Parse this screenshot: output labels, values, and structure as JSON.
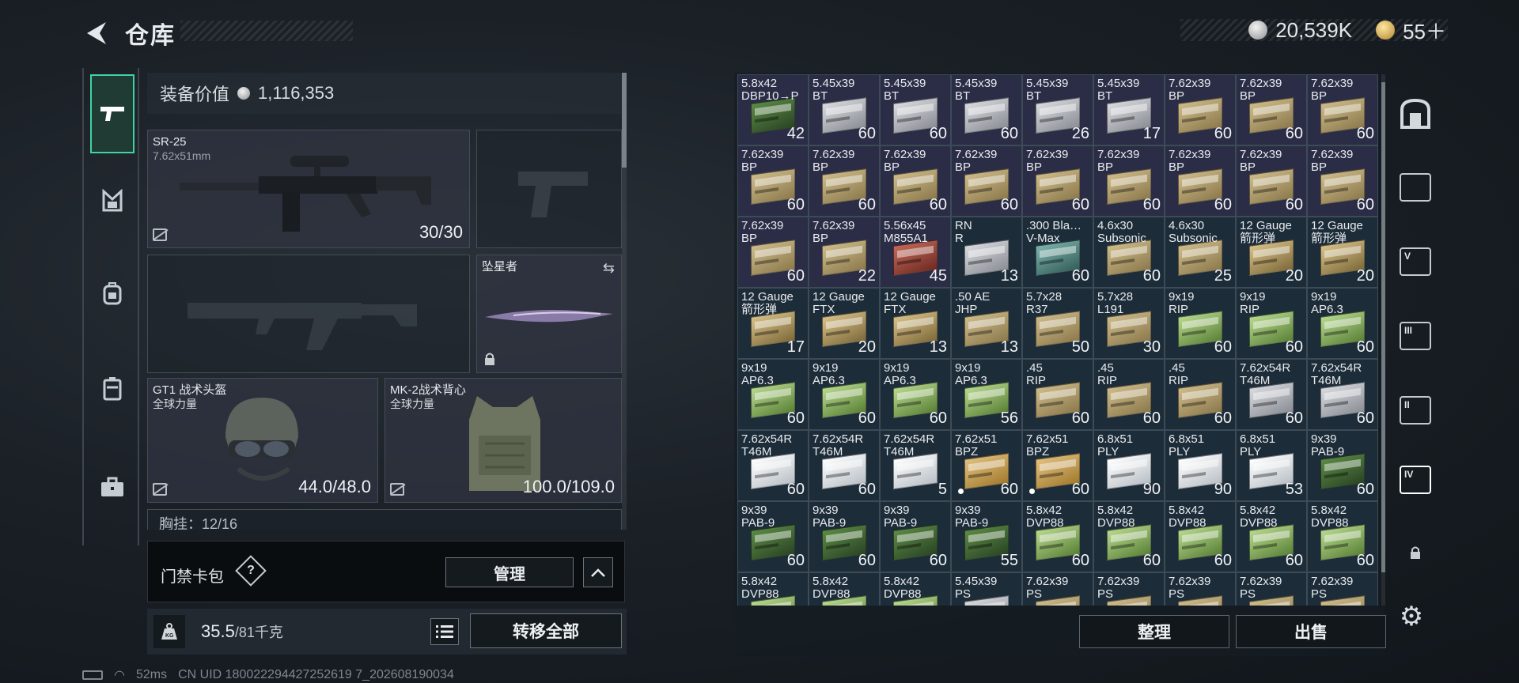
{
  "header": {
    "title": "仓库",
    "silver_amount": "20,539K",
    "gold_amount": "55＋"
  },
  "equipment": {
    "value_label": "装备价值",
    "value_amount": "1,116,353",
    "primary": {
      "name": "SR-25",
      "caliber": "7.62x51mm",
      "ammo": "30/30"
    },
    "melee": {
      "name": "坠星者"
    },
    "helmet": {
      "name": "GT1 战术头盔",
      "maker": "全球力量",
      "durability": "44.0/48.0"
    },
    "vest": {
      "name": "MK-2战术背心",
      "maker": "全球力量",
      "durability": "100.0/109.0"
    },
    "next_row_label": "胸挂：12/16"
  },
  "keycard": {
    "label": "门禁卡包",
    "help": "?",
    "manage": "管理"
  },
  "weight": {
    "current": "35.5",
    "max": "/81千克",
    "transfer_all": "转移全部"
  },
  "status": {
    "ping": "52ms",
    "uid": "CN UID 180022294427252619 7_202608190034"
  },
  "inventory_actions": {
    "sort": "整理",
    "sell": "出售"
  },
  "inventory_side_icons": [
    "bag-icon",
    "category-all-icon",
    "category-v-icon",
    "category-iii-icon",
    "category-ii-icon",
    "category-iv-icon",
    "lock-icon"
  ],
  "inventory": [
    {
      "cal": "5.8x42",
      "var": "DBP10→P",
      "qty": "42",
      "color": "darkgreen",
      "purple": true
    },
    {
      "cal": "5.45x39",
      "var": "BT",
      "qty": "60",
      "color": "silver",
      "purple": true
    },
    {
      "cal": "5.45x39",
      "var": "BT",
      "qty": "60",
      "color": "silver",
      "purple": true
    },
    {
      "cal": "5.45x39",
      "var": "BT",
      "qty": "60",
      "color": "silver",
      "purple": true
    },
    {
      "cal": "5.45x39",
      "var": "BT",
      "qty": "26",
      "color": "silver",
      "purple": true
    },
    {
      "cal": "5.45x39",
      "var": "BT",
      "qty": "17",
      "color": "silver",
      "purple": true
    },
    {
      "cal": "7.62x39",
      "var": "BP",
      "qty": "60",
      "color": "tan",
      "purple": true
    },
    {
      "cal": "7.62x39",
      "var": "BP",
      "qty": "60",
      "color": "tan",
      "purple": true
    },
    {
      "cal": "7.62x39",
      "var": "BP",
      "qty": "60",
      "color": "tan",
      "purple": true
    },
    {
      "cal": "7.62x39",
      "var": "BP",
      "qty": "60",
      "color": "tan",
      "purple": true
    },
    {
      "cal": "7.62x39",
      "var": "BP",
      "qty": "60",
      "color": "tan",
      "purple": true
    },
    {
      "cal": "7.62x39",
      "var": "BP",
      "qty": "60",
      "color": "tan",
      "purple": true
    },
    {
      "cal": "7.62x39",
      "var": "BP",
      "qty": "60",
      "color": "tan",
      "purple": true
    },
    {
      "cal": "7.62x39",
      "var": "BP",
      "qty": "60",
      "color": "tan",
      "purple": true
    },
    {
      "cal": "7.62x39",
      "var": "BP",
      "qty": "60",
      "color": "tan",
      "purple": true
    },
    {
      "cal": "7.62x39",
      "var": "BP",
      "qty": "60",
      "color": "tan",
      "purple": true
    },
    {
      "cal": "7.62x39",
      "var": "BP",
      "qty": "60",
      "color": "tan",
      "purple": true
    },
    {
      "cal": "7.62x39",
      "var": "BP",
      "qty": "60",
      "color": "tan",
      "purple": true
    },
    {
      "cal": "7.62x39",
      "var": "BP",
      "qty": "60",
      "color": "tan",
      "purple": true
    },
    {
      "cal": "7.62x39",
      "var": "BP",
      "qty": "22",
      "color": "tan",
      "purple": true
    },
    {
      "cal": "5.56x45",
      "var": "M855A1",
      "qty": "45",
      "color": "red",
      "purple": true
    },
    {
      "cal": "RN",
      "var": "R",
      "qty": "13",
      "color": "silver",
      "purple": false
    },
    {
      "cal": ".300 Bla…",
      "var": "V-Max",
      "qty": "60",
      "color": "teal",
      "purple": false
    },
    {
      "cal": "4.6x30",
      "var": "Subsonic",
      "qty": "60",
      "color": "tan",
      "purple": false
    },
    {
      "cal": "4.6x30",
      "var": "Subsonic",
      "qty": "25",
      "color": "tan",
      "purple": false
    },
    {
      "cal": "12 Gauge",
      "var": "箭形弹",
      "qty": "20",
      "color": "shells",
      "purple": false
    },
    {
      "cal": "12 Gauge",
      "var": "箭形弹",
      "qty": "20",
      "color": "shells",
      "purple": false
    },
    {
      "cal": "12 Gauge",
      "var": "箭形弹",
      "qty": "17",
      "color": "shells",
      "purple": false
    },
    {
      "cal": "12 Gauge",
      "var": "FTX",
      "qty": "20",
      "color": "shells",
      "purple": false
    },
    {
      "cal": "12 Gauge",
      "var": "FTX",
      "qty": "13",
      "color": "shells",
      "purple": false
    },
    {
      "cal": ".50 AE",
      "var": "JHP",
      "qty": "13",
      "color": "tan",
      "purple": false
    },
    {
      "cal": "5.7x28",
      "var": "R37",
      "qty": "50",
      "color": "tan",
      "purple": false
    },
    {
      "cal": "5.7x28",
      "var": "L191",
      "qty": "30",
      "color": "tan",
      "purple": false
    },
    {
      "cal": "9x19",
      "var": "RIP",
      "qty": "60",
      "color": "green",
      "purple": false
    },
    {
      "cal": "9x19",
      "var": "RIP",
      "qty": "60",
      "color": "green",
      "purple": false
    },
    {
      "cal": "9x19",
      "var": "AP6.3",
      "qty": "60",
      "color": "green",
      "purple": false
    },
    {
      "cal": "9x19",
      "var": "AP6.3",
      "qty": "60",
      "color": "green",
      "purple": false
    },
    {
      "cal": "9x19",
      "var": "AP6.3",
      "qty": "60",
      "color": "green",
      "purple": false
    },
    {
      "cal": "9x19",
      "var": "AP6.3",
      "qty": "60",
      "color": "green",
      "purple": false
    },
    {
      "cal": "9x19",
      "var": "AP6.3",
      "qty": "56",
      "color": "green",
      "purple": false
    },
    {
      "cal": ".45",
      "var": "RIP",
      "qty": "60",
      "color": "tan",
      "purple": false
    },
    {
      "cal": ".45",
      "var": "RIP",
      "qty": "60",
      "color": "tan",
      "purple": false
    },
    {
      "cal": ".45",
      "var": "RIP",
      "qty": "60",
      "color": "tan",
      "purple": false
    },
    {
      "cal": "7.62x54R",
      "var": "T46M",
      "qty": "60",
      "color": "silver",
      "purple": false
    },
    {
      "cal": "7.62x54R",
      "var": "T46M",
      "qty": "60",
      "color": "silver",
      "purple": false
    },
    {
      "cal": "7.62x54R",
      "var": "T46M",
      "qty": "60",
      "color": "white",
      "purple": false
    },
    {
      "cal": "7.62x54R",
      "var": "T46M",
      "qty": "60",
      "color": "white",
      "purple": false
    },
    {
      "cal": "7.62x54R",
      "var": "T46M",
      "qty": "5",
      "color": "white",
      "purple": false
    },
    {
      "cal": "7.62x51",
      "var": "BPZ",
      "qty": "60",
      "color": "gold",
      "purple": false,
      "dot": true
    },
    {
      "cal": "7.62x51",
      "var": "BPZ",
      "qty": "60",
      "color": "gold",
      "purple": false,
      "dot": true
    },
    {
      "cal": "6.8x51",
      "var": "PLY",
      "qty": "90",
      "color": "white",
      "purple": false
    },
    {
      "cal": "6.8x51",
      "var": "PLY",
      "qty": "90",
      "color": "white",
      "purple": false
    },
    {
      "cal": "6.8x51",
      "var": "PLY",
      "qty": "53",
      "color": "white",
      "purple": false
    },
    {
      "cal": "9x39",
      "var": "PAB-9",
      "qty": "60",
      "color": "darkgreen",
      "purple": false
    },
    {
      "cal": "9x39",
      "var": "PAB-9",
      "qty": "60",
      "color": "darkgreen",
      "purple": false
    },
    {
      "cal": "9x39",
      "var": "PAB-9",
      "qty": "60",
      "color": "darkgreen",
      "purple": false
    },
    {
      "cal": "9x39",
      "var": "PAB-9",
      "qty": "60",
      "color": "darkgreen",
      "purple": false
    },
    {
      "cal": "9x39",
      "var": "PAB-9",
      "qty": "55",
      "color": "darkgreen",
      "purple": false
    },
    {
      "cal": "5.8x42",
      "var": "DVP88",
      "qty": "60",
      "color": "green",
      "purple": false
    },
    {
      "cal": "5.8x42",
      "var": "DVP88",
      "qty": "60",
      "color": "green",
      "purple": false
    },
    {
      "cal": "5.8x42",
      "var": "DVP88",
      "qty": "60",
      "color": "green",
      "purple": false
    },
    {
      "cal": "5.8x42",
      "var": "DVP88",
      "qty": "60",
      "color": "green",
      "purple": false
    },
    {
      "cal": "5.8x42",
      "var": "DVP88",
      "qty": "60",
      "color": "green",
      "purple": false
    },
    {
      "cal": "5.8x42",
      "var": "DVP88",
      "qty": "",
      "color": "green",
      "purple": false
    },
    {
      "cal": "5.8x42",
      "var": "DVP88",
      "qty": "",
      "color": "green",
      "purple": false
    },
    {
      "cal": "5.8x42",
      "var": "DVP88",
      "qty": "",
      "color": "green",
      "purple": false
    },
    {
      "cal": "5.45x39",
      "var": "PS",
      "qty": "",
      "color": "silver",
      "purple": false
    },
    {
      "cal": "7.62x39",
      "var": "PS",
      "qty": "",
      "color": "tan",
      "purple": false
    },
    {
      "cal": "7.62x39",
      "var": "PS",
      "qty": "",
      "color": "tan",
      "purple": false
    },
    {
      "cal": "7.62x39",
      "var": "PS",
      "qty": "",
      "color": "tan",
      "purple": false
    },
    {
      "cal": "7.62x39",
      "var": "PS",
      "qty": "",
      "color": "tan",
      "purple": false
    },
    {
      "cal": "7.62x39",
      "var": "PS",
      "qty": "",
      "color": "tan",
      "purple": false
    }
  ]
}
